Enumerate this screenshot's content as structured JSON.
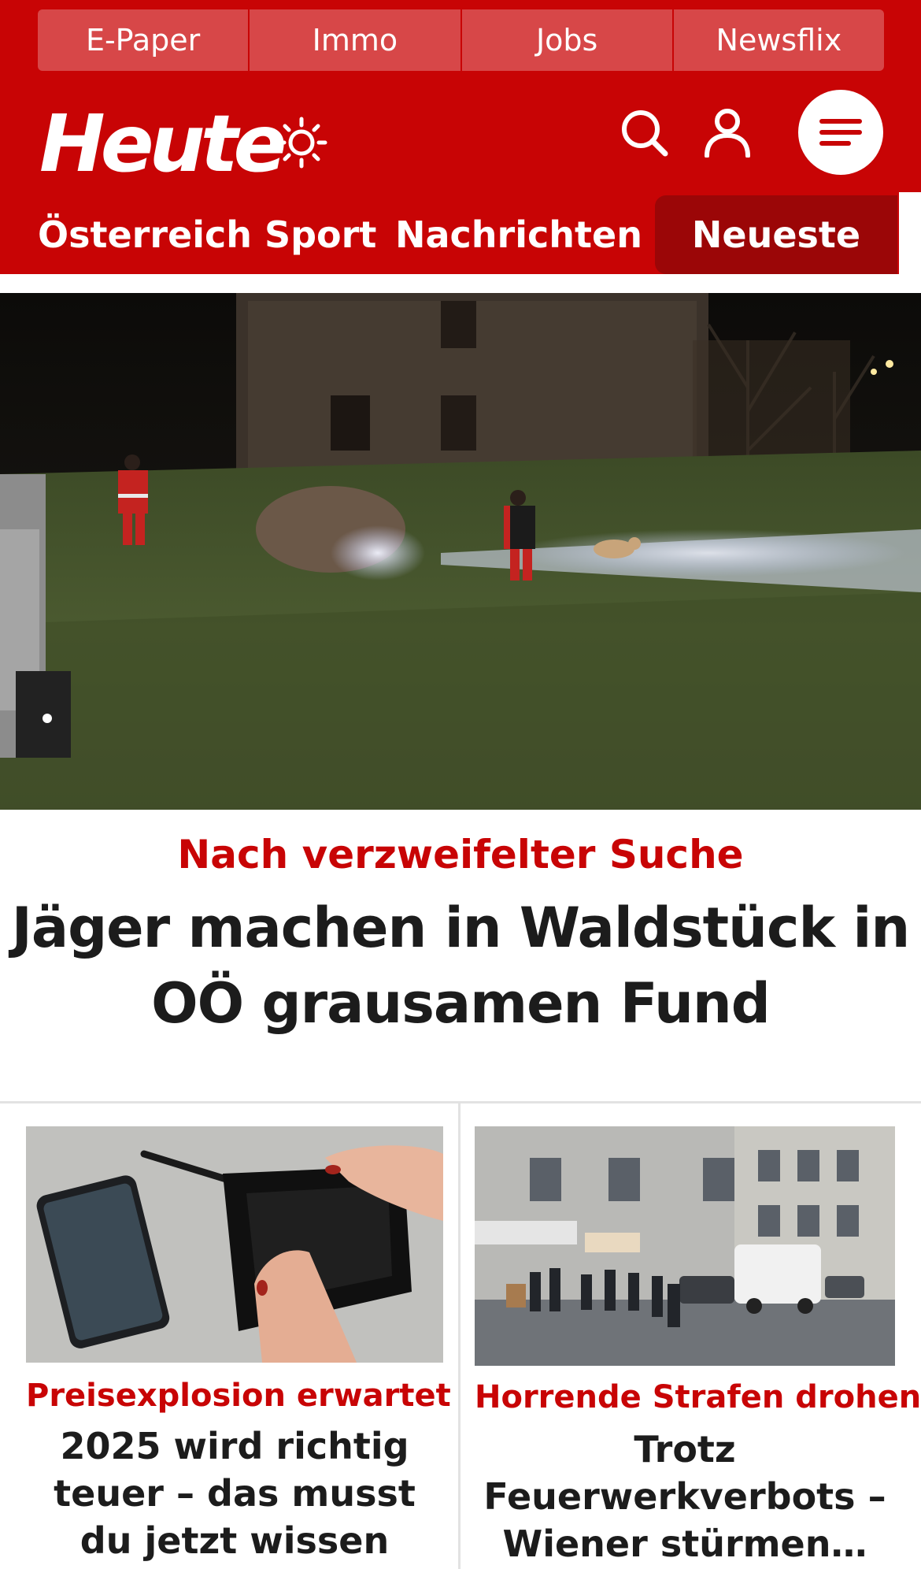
{
  "top_links": [
    "E-Paper",
    "Immo",
    "Jobs",
    "Newsflix"
  ],
  "logo_text": "Heute",
  "icons": {
    "weather": "sun-icon",
    "search": "search-icon",
    "account": "user-icon",
    "menu": "menu-icon"
  },
  "nav": {
    "items": [
      "Österreich",
      "Sport",
      "Nachrichten"
    ],
    "active": "Neueste"
  },
  "colors": {
    "brand_red": "#c80405",
    "top_link_bg": "#d74748",
    "active_tab": "#9b0607",
    "text": "#1c1c1c"
  },
  "hero": {
    "kicker": "Nach verzweifelter Suche",
    "title": "Jäger machen in Waldstück in OÖ grausamen Fund"
  },
  "teasers": [
    {
      "kicker": "Preisexplosion erwartet",
      "title": "2025 wird richtig teuer – das musst du jetzt wissen"
    },
    {
      "kicker": "Horrende Strafen drohen",
      "title": "Trotz Feuerwerkverbots – Wiener stürmen…"
    }
  ]
}
